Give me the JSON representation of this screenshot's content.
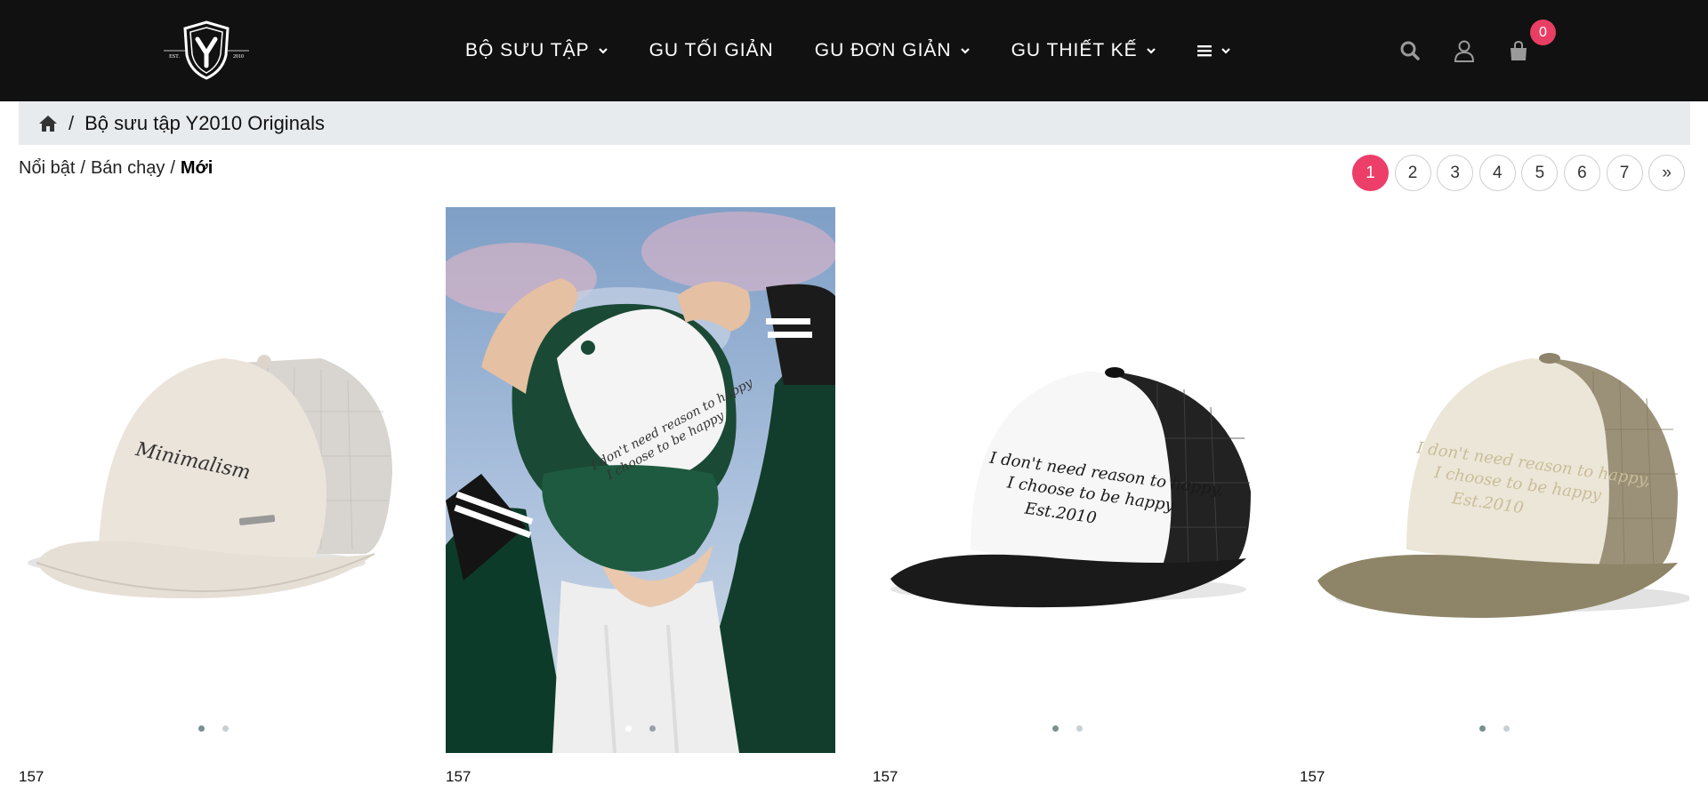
{
  "header": {
    "logo": {
      "text_left": "EST.",
      "letter": "Y",
      "text_right": "2010"
    },
    "nav": [
      {
        "label": "BỘ SƯU TẬP",
        "has_dropdown": true
      },
      {
        "label": "GU TỐI GIẢN",
        "has_dropdown": false
      },
      {
        "label": "GU ĐƠN GIẢN",
        "has_dropdown": true
      },
      {
        "label": "GU THIẾT KẾ",
        "has_dropdown": true
      }
    ],
    "menu_icon": "hamburger-icon",
    "icons": [
      "search-icon",
      "user-icon",
      "shopping-bag-icon"
    ],
    "cart_count": "0",
    "colors": {
      "background": "#111111",
      "accent": "#e93e64"
    }
  },
  "breadcrumb": {
    "home_icon": "home-icon",
    "separator": "/",
    "current": "Bộ sưu tập Y2010 Originals"
  },
  "sort": {
    "options": [
      "Nổi bật",
      "Bán chạy",
      "Mới"
    ],
    "separator": "/",
    "active": "Mới"
  },
  "pagination": {
    "pages": [
      "1",
      "2",
      "3",
      "4",
      "5",
      "6",
      "7"
    ],
    "next": "»",
    "current": "1",
    "accent": "#ec3e68"
  },
  "products": [
    {
      "price": "157",
      "image": "beige trucker cap with Minimalism embroidery",
      "slides": 2,
      "active_slide": 1
    },
    {
      "price": "157",
      "image": "model wearing green and white trucker cap",
      "slides": 2,
      "active_slide": 1
    },
    {
      "price": "157",
      "image": "black and white trucker cap with script embroidery",
      "slides": 2,
      "active_slide": 1
    },
    {
      "price": "157",
      "image": "khaki and cream trucker cap with script embroidery",
      "slides": 2,
      "active_slide": 1
    }
  ]
}
